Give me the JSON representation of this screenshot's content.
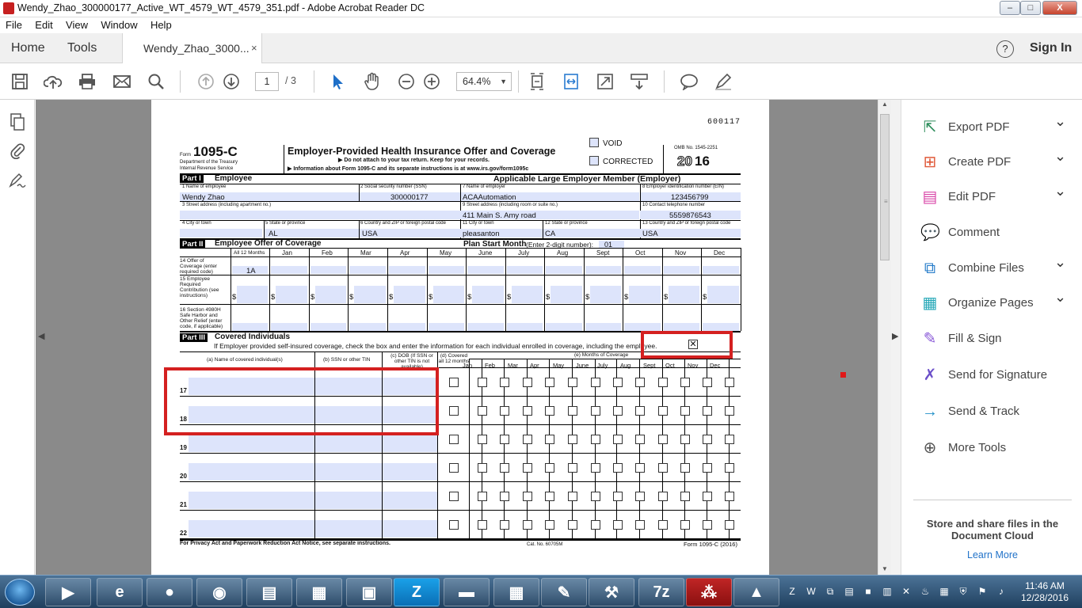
{
  "window": {
    "title": "Wendy_Zhao_300000177_Active_WT_4579_WT_4579_351.pdf - Adobe Acrobat Reader DC",
    "minimize": "‒",
    "maximize": "□",
    "close": "X"
  },
  "menu": [
    "File",
    "Edit",
    "View",
    "Window",
    "Help"
  ],
  "tabs": {
    "home": "Home",
    "tools": "Tools",
    "document": "Wendy_Zhao_3000...",
    "close": "×",
    "help_icon": "?",
    "sign_in": "Sign In"
  },
  "toolbar": {
    "page_current": "1",
    "page_total": "/ 3",
    "zoom": "64.4%",
    "icons": [
      "save-icon",
      "upload-icon",
      "print-icon",
      "email-icon",
      "search-icon",
      "page-up-icon",
      "page-down-icon",
      "select-cursor-icon",
      "hand-icon",
      "zoom-out-icon",
      "zoom-in-icon",
      "fit-page-icon",
      "fit-width-icon",
      "full-screen-icon",
      "scroll-mode-icon",
      "comment-icon",
      "highlight-pen-icon"
    ]
  },
  "right_pane": {
    "items": [
      {
        "label": "Export PDF",
        "icon": "export-pdf-icon",
        "color": "#2c8c5a",
        "chevron": true
      },
      {
        "label": "Create PDF",
        "icon": "create-pdf-icon",
        "color": "#e05a3a",
        "chevron": true
      },
      {
        "label": "Edit PDF",
        "icon": "edit-pdf-icon",
        "color": "#d946a8",
        "chevron": true
      },
      {
        "label": "Comment",
        "icon": "comment-tool-icon",
        "color": "#f0b400",
        "chevron": false
      },
      {
        "label": "Combine Files",
        "icon": "combine-files-icon",
        "color": "#1f78c8",
        "chevron": true
      },
      {
        "label": "Organize Pages",
        "icon": "organize-pages-icon",
        "color": "#26a8b8",
        "chevron": true
      },
      {
        "label": "Fill & Sign",
        "icon": "fill-sign-icon",
        "color": "#8a5ad8",
        "chevron": false
      },
      {
        "label": "Send for Signature",
        "icon": "send-signature-icon",
        "color": "#6b4fc9",
        "chevron": false
      },
      {
        "label": "Send & Track",
        "icon": "send-track-icon",
        "color": "#2290c8",
        "chevron": false
      },
      {
        "label": "More Tools",
        "icon": "more-tools-icon",
        "color": "#555555",
        "chevron": false
      }
    ],
    "cloud_heading": "Store and share files in the Document Cloud",
    "cloud_link": "Learn More"
  },
  "form": {
    "form_no": "600117",
    "form_word": "Form",
    "form_id": "1095-C",
    "dept": "Department of the Treasury",
    "irs": "Internal Revenue Service",
    "title": "Employer-Provided Health Insurance Offer and Coverage",
    "subtitle1": "▶ Do not attach to your tax return. Keep for your records.",
    "subtitle2": "▶ Information about Form 1095-C and its separate instructions is at www.irs.gov/form1095c",
    "void": "VOID",
    "corrected": "CORRECTED",
    "omb": "OMB No. 1545-2251",
    "year_prefix": "20",
    "year_suffix": "16",
    "part1": "Part I",
    "part1_title": "Employee",
    "employer_title": "Applicable Large Employer Member (Employer)",
    "l1": "1 Name of employee",
    "l2": "2 Social security number (SSN)",
    "l7": "7 Name of employer",
    "l8": "8 Employer identification number (EIN)",
    "v1": "Wendy Zhao",
    "v2": "300000177",
    "v7": "ACAAutomation",
    "v8": "123456799",
    "l3": "3 Street address (including apartment no.)",
    "l9": "9 Street address (including room or suite no.)",
    "l10": "10 Contact telephone number",
    "v9": "411 Main S. Amy road",
    "v10": "5559876543",
    "l4": "4 City or town",
    "l5": "5 State or province",
    "l6": "6 Country and ZIP or foreign postal code",
    "l11": "11 City or town",
    "l12": "12 State or province",
    "l13": "13 Country and ZIP or foreign postal code",
    "v5": "AL",
    "v6": "USA",
    "v11": "pleasanton",
    "v12": "CA",
    "v13": "USA",
    "part2": "Part II",
    "part2_title": "Employee Offer of Coverage",
    "plan_start": "Plan Start Month",
    "plan_start_note": "(Enter 2-digit number):",
    "plan_start_val": "01",
    "months_all": "All 12 Months",
    "months": [
      "Jan",
      "Feb",
      "Mar",
      "Apr",
      "May",
      "June",
      "July",
      "Aug",
      "Sept",
      "Oct",
      "Nov",
      "Dec"
    ],
    "l14": "14 Offer of Coverage (enter required code)",
    "v14": "1A",
    "l15": "15 Employee Required Contribution (see instructions)",
    "dollar": "$",
    "l16": "16 Section 4980H Safe Harbor and Other Relief (enter code, if applicable)",
    "part3": "Part III",
    "part3_title": "Covered Individuals",
    "part3_note": "If Employer provided self-insured coverage, check the box and enter the information for each individual enrolled in coverage, including the employee.",
    "part3_check": "✕",
    "col_a": "(a) Name of covered individual(s)",
    "col_b": "(b) SSN or other TIN",
    "col_c": "(c) DOB (If SSN or other TIN is not available)",
    "col_d": "(d) Covered all 12 months",
    "col_e": "(e) Months of Coverage",
    "months_short": [
      "Jan",
      "Feb",
      "Mar",
      "Apr",
      "May",
      "June",
      "July",
      "Aug",
      "Sept",
      "Oct",
      "Nov",
      "Dec"
    ],
    "rows": [
      "17",
      "18",
      "19",
      "20",
      "21",
      "22"
    ],
    "footer_left": "For Privacy Act and Paperwork Reduction Act Notice, see separate instructions.",
    "footer_cat": "Cat. No. 60705M",
    "footer_form": "Form 1095-C (2016)"
  },
  "taskbar": {
    "apps": [
      "media-player-icon",
      "internet-explorer-icon",
      "firefox-icon",
      "chrome-icon",
      "notepad-icon",
      "sticky-notes-icon",
      "terminal-icon",
      "zoom-z-icon",
      "file-explorer-icon",
      "calculator-icon",
      "editor-icon",
      "tools-icon",
      "7zip-icon",
      "acrobat-icon",
      "burn-icon"
    ],
    "app_labels": [
      "▶",
      "e",
      "●",
      "◉",
      "▤",
      "▦",
      "▣",
      "Z",
      "▬",
      "▦",
      "✎",
      "⚒",
      "7z",
      "⁂",
      "▲"
    ],
    "time": "11:46 AM",
    "date": "12/28/2016"
  }
}
